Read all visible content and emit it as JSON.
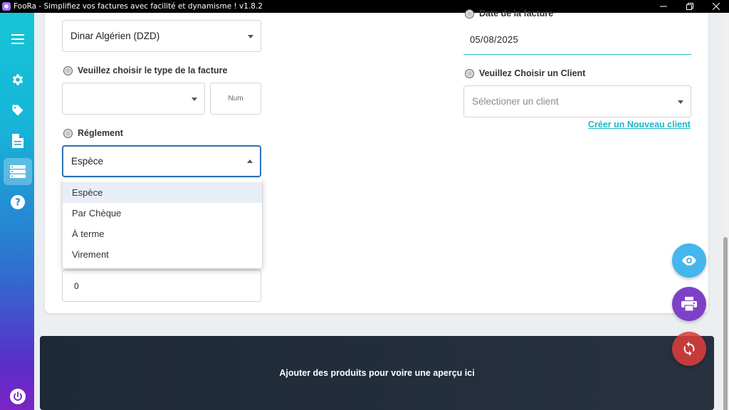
{
  "window": {
    "title": "FooRa - Simplifiez vos factures avec facilité et dynamisme ! v1.8.2",
    "controls": [
      "minimize",
      "restore",
      "close"
    ]
  },
  "sidebar": {
    "items": [
      {
        "icon": "menu-icon"
      },
      {
        "icon": "gear-icon"
      },
      {
        "icon": "tag-icon"
      },
      {
        "icon": "document-icon"
      },
      {
        "icon": "list-icon",
        "active": true
      },
      {
        "icon": "help-icon"
      }
    ],
    "footer_icon": "power-icon"
  },
  "form": {
    "currency_value": "Dinar Algérien (DZD)",
    "invoice_type_label": "Veuillez choisir le type de la facture",
    "invoice_type_value": "",
    "num_placeholder": "Num",
    "reglement_label": "Réglement",
    "reglement_value": "Espèce",
    "reglement_options": [
      "Espèce",
      "Par Chèque",
      "À terme",
      "Virement"
    ],
    "amount_value": "0",
    "date_label": "Date de la facture",
    "date_value": "05/08/2025",
    "client_label": "Veuillez Choisir un Client",
    "client_placeholder": "Sélectioner un client",
    "new_client_link": "Créer un Nouveau client"
  },
  "preview": {
    "message": "Ajouter des produits pour voire une aperçu ici"
  },
  "fabs": [
    "eye-icon",
    "printer-icon",
    "refresh-icon"
  ],
  "colors": {
    "accent": "#1fb6c8",
    "eye_fab": "#45b6ee",
    "print_fab": "#7f40c8",
    "refresh_fab": "#dc3c3c",
    "preview_bg": "#1e2938"
  }
}
